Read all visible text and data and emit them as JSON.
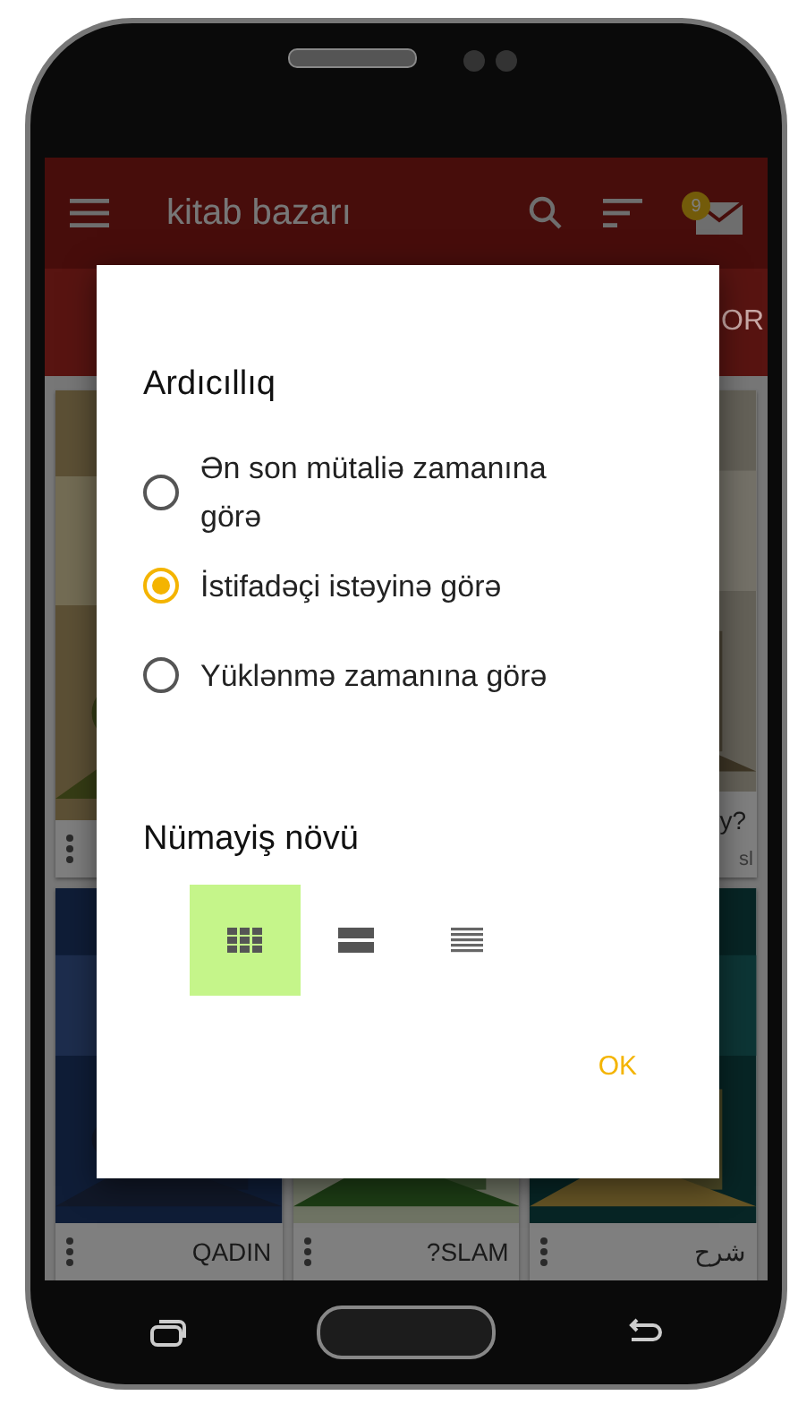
{
  "app_bar": {
    "title": "kitab bazarı",
    "badge": "9"
  },
  "tab_fragment": "OR",
  "books": [
    {
      "kind": "picture"
    },
    {
      "kind": "picture",
      "caption": "y?",
      "subtitle": "sl"
    },
    {
      "kind": "picture",
      "caption": "QADIN"
    },
    {
      "kind": "picture",
      "caption": "?SLAM"
    },
    {
      "kind": "picture",
      "caption": "شرح"
    }
  ],
  "dialog": {
    "title": "Ardıcıllıq",
    "options": [
      {
        "label": "Ən son mütaliə zamanına görə",
        "selected": false
      },
      {
        "label": "İstifadəçi istəyinə görə",
        "selected": true
      },
      {
        "label": "Yüklənmə zamanına görə",
        "selected": false
      }
    ],
    "view_title": "Nümayiş növü",
    "view_modes": [
      {
        "kind": "grid",
        "selected": true
      },
      {
        "kind": "rows",
        "selected": false
      },
      {
        "kind": "list",
        "selected": false
      }
    ],
    "ok": "OK"
  }
}
